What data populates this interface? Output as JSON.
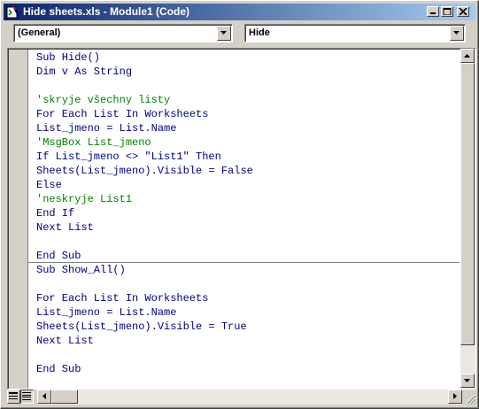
{
  "window": {
    "title": "Hide sheets.xls - Module1 (Code)",
    "title_bar_color": "#0a246a"
  },
  "combos": {
    "object": "(General)",
    "procedure": "Hide"
  },
  "colors": {
    "keyword": "#00007f",
    "comment": "#007f00",
    "text": "#000000"
  },
  "code": {
    "lines": [
      "Sub Hide()",
      "Dim v As String",
      "",
      "'skryje všechny listy",
      "For Each List In Worksheets",
      "List_jmeno = List.Name",
      "'MsgBox List_jmeno",
      "If List_jmeno <> \"List1\" Then",
      "Sheets(List_jmeno).Visible = False",
      "Else",
      "'neskryje List1",
      "End If",
      "Next List",
      "",
      "End Sub",
      "Sub Show_All()",
      "",
      "For Each List In Worksheets",
      "List_jmeno = List.Name",
      "Sheets(List_jmeno).Visible = True",
      "Next List",
      "",
      "End Sub"
    ]
  }
}
